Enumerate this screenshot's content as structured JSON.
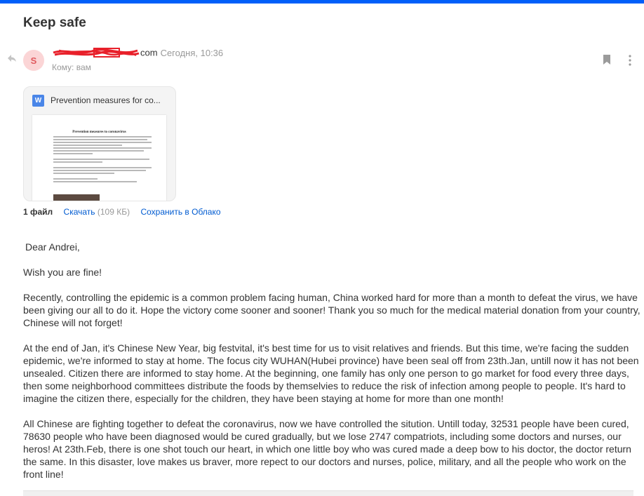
{
  "subject": "Keep safe",
  "sender": {
    "avatar_letter": "S",
    "email_tail": "com",
    "date": "Сегодня, 10:36",
    "to_line": "Кому: вам"
  },
  "attachment": {
    "name": "Prevention measures for co...",
    "doc_badge": "W",
    "doc_title": "Prevention measures to coronavirus"
  },
  "files": {
    "count": "1 файл",
    "download": "Скачать",
    "size": "(109 КБ)",
    "save_cloud": "Сохранить в Облако"
  },
  "body": {
    "greeting": "Dear Andrei,",
    "p1": "Wish you are fine!",
    "p2": "Recently, controlling the epidemic is a common problem facing human, China worked hard for more than a month to defeat the virus, we have been giving our all to do it. Hope the victory come sooner and sooner! Thank you so much for the medical material donation from your country, Chinese will not forget!",
    "p3": "At the end of Jan, it's Chinese New Year, big festvital, it's best time for us to visit relatives and friends. But this time, we're facing the sudden epidemic, we're informed to stay at home. The focus city WUHAN(Hubei province) have been seal off from 23th.Jan, untill now it has not been unsealed. Citizen there are informed to stay home. At the beginning, one family has only one person to go market for food every three days, then some neighborhood committees distribute the foods by themselvies to reduce the risk of infection among people to people. It's hard to imagine the citizen there, especially for the children, they have been staying at home for more than one month!",
    "p4": "All Chinese are fighting together to defeat the coronavirus, now we have controlled the sitution. Untill today, 32531 people have been cured, 78630 people who have been diagnosed would be cured gradually, but we lose 2747 compatriots, including some doctors and nurses, our heros! At 23th.Feb, there is one shot touch our heart, in which one little boy who was cured made a deep bow to his doctor, the doctor return the same. In this disaster, love makes us braver, more repect to our doctors and nurses, police, military, and all the people who work on the front line!"
  },
  "colors": {
    "accent": "#005ff9",
    "link": "#005bd1",
    "avatar_bg": "#fbd5d6",
    "avatar_text": "#e05a5f",
    "redaction": "#e8202a"
  },
  "icons": [
    "reply-icon",
    "bookmark-icon",
    "more-icon",
    "word-doc-icon"
  ]
}
